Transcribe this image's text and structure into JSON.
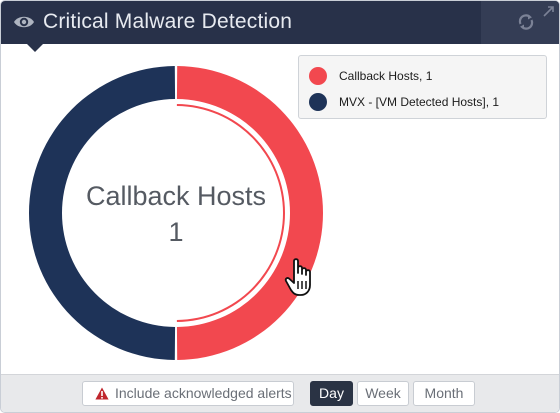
{
  "widget": {
    "title": "Critical Malware Detection",
    "icons": {
      "view": "eye-icon",
      "refresh": "refresh-icon",
      "expand": "expand-icon"
    }
  },
  "chart_data": {
    "type": "pie",
    "categories": [
      "Callback Hosts",
      "MVX - [VM Detected Hosts]"
    ],
    "values": [
      1,
      1
    ],
    "colors": [
      "#f2484f",
      "#1e3358"
    ],
    "legend_labels": [
      "Callback Hosts, 1",
      "MVX - [VM Detected Hosts], 1"
    ],
    "legend_placement": "top-right",
    "center_label": "Callback Hosts",
    "center_value": "1",
    "highlighted": "Callback Hosts"
  },
  "footer": {
    "ack_label": "Include acknowledged alerts",
    "ranges": [
      "Day",
      "Week",
      "Month"
    ],
    "selected_range": "Day"
  },
  "colors": {
    "header_bg": "#283149",
    "accent_red": "#f2484f",
    "accent_navy": "#1e3358"
  }
}
